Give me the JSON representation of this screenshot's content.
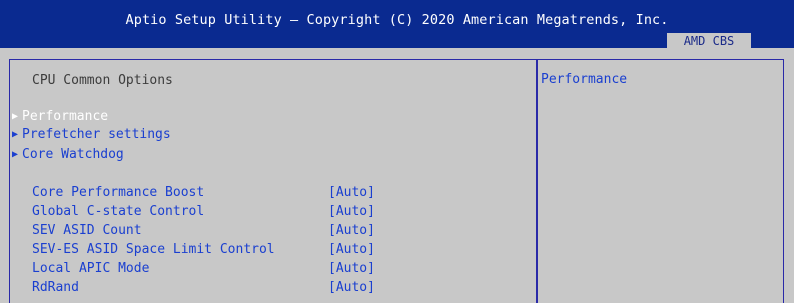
{
  "header": {
    "title": "Aptio Setup Utility – Copyright (C) 2020 American Megatrends, Inc.",
    "active_tab": "AMD CBS"
  },
  "main": {
    "section_heading": "CPU Common Options",
    "submenus": [
      {
        "label": "Performance",
        "selected": true
      },
      {
        "label": "Prefetcher settings",
        "selected": false
      },
      {
        "label": "Core Watchdog",
        "selected": false
      }
    ],
    "settings": [
      {
        "label": "Core Performance Boost",
        "value": "[Auto]"
      },
      {
        "label": "Global C-state Control",
        "value": "[Auto]"
      },
      {
        "label": "SEV ASID Count",
        "value": "[Auto]"
      },
      {
        "label": "SEV-ES ASID Space Limit Control",
        "value": "[Auto]"
      },
      {
        "label": "Local APIC Mode",
        "value": "[Auto]"
      },
      {
        "label": "RdRand",
        "value": "[Auto]"
      }
    ]
  },
  "help": {
    "text": "Performance"
  },
  "colors": {
    "title_bar": "#0a2a90",
    "background": "#c8c8c8",
    "item_text": "#1a3fd0",
    "selected_text": "#ffffff",
    "heading_text": "#3c3c3c"
  },
  "icons": {
    "submenu_marker": "triangle-right-icon"
  }
}
